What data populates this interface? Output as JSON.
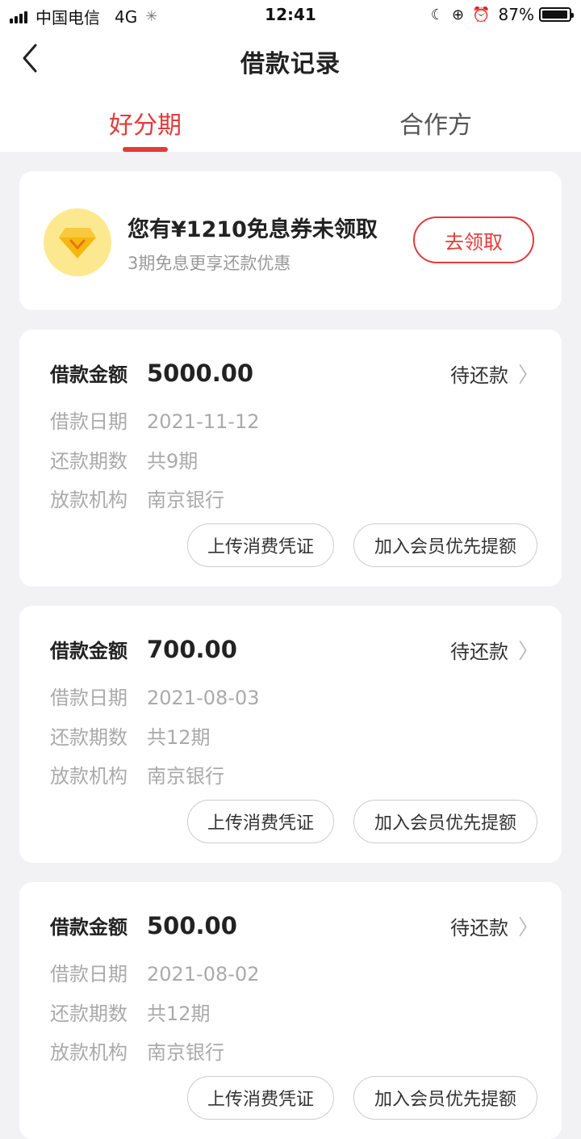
{
  "status_bar": {
    "carrier": "中国电信",
    "network": "4G",
    "time": "12:41",
    "battery": "87%",
    "icons": [
      "signal-icon",
      "loading-icon",
      "moon-icon",
      "rotation-lock-icon",
      "alarm-icon",
      "battery-icon"
    ]
  },
  "header": {
    "title": "借款记录"
  },
  "tabs": [
    {
      "label": "好分期",
      "active": true
    },
    {
      "label": "合作方",
      "active": false
    }
  ],
  "promo": {
    "title": "您有¥1210免息券未领取",
    "subtitle": "3期免息更享还款优惠",
    "button": "去领取",
    "icon": "diamond-icon"
  },
  "labels": {
    "amount": "借款金额",
    "date": "借款日期",
    "term": "还款期数",
    "institution": "放款机构",
    "upload": "上传消费凭证",
    "member": "加入会员优先提额"
  },
  "loans": [
    {
      "amount": "5000.00",
      "status": "待还款",
      "date": "2021-11-12",
      "term": "共9期",
      "institution": "南京银行"
    },
    {
      "amount": "700.00",
      "status": "待还款",
      "date": "2021-08-03",
      "term": "共12期",
      "institution": "南京银行"
    },
    {
      "amount": "500.00",
      "status": "待还款",
      "date": "2021-08-02",
      "term": "共12期",
      "institution": "南京银行"
    }
  ],
  "colors": {
    "accent": "#e33a3a",
    "background": "#f2f2f4",
    "promo_icon_bg": "#fce98f",
    "promo_icon_fg": "#f5b80f"
  }
}
